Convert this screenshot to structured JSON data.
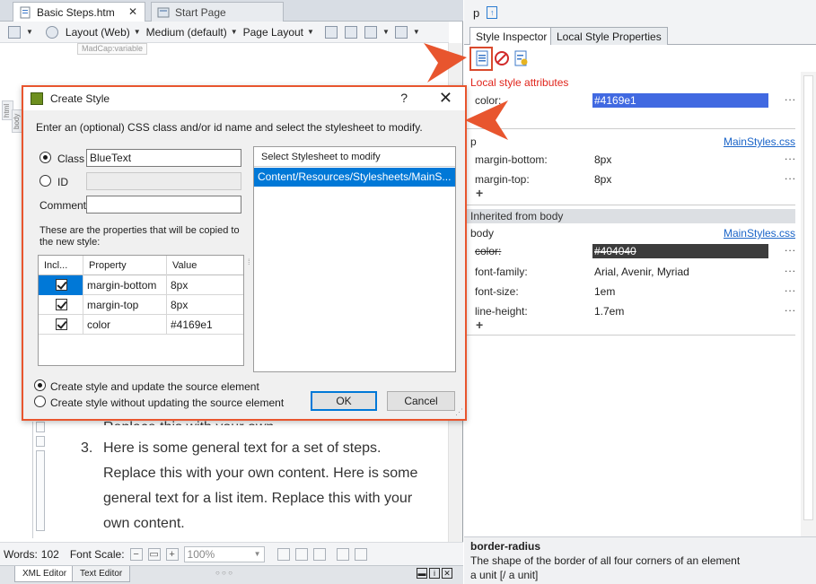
{
  "editor": {
    "tabs": [
      {
        "label": "Basic Steps.htm",
        "close": "✕"
      },
      {
        "label": "Start Page"
      }
    ],
    "toolbar": {
      "layout": "Layout (Web)",
      "medium": "Medium (default)",
      "page_layout": "Page Layout"
    },
    "variable_tag": "MadCap:variable",
    "gutter_tags": {
      "html": "html",
      "body": "body"
    },
    "partial_line": "Replace this with your own content.",
    "list_item": {
      "number": "3.",
      "text": "Here is some general text for a set of steps. Replace this with your own content. Here is some general text for a list item. Replace this with your own content."
    },
    "status": {
      "words_label": "Words:",
      "words_value": "102",
      "font_scale_label": "Font Scale:",
      "zoom": "100%"
    },
    "bottom_tabs": [
      "XML Editor",
      "Text Editor"
    ]
  },
  "panel": {
    "element": "p",
    "tabs": [
      "Style Inspector",
      "Local Style Properties"
    ],
    "local_section_title": "Local style attributes",
    "local_props": [
      {
        "name": "color:",
        "value": "#4169e1",
        "dots": "..."
      }
    ],
    "p_section": {
      "name": "p",
      "link": "MainStyles.css",
      "props": [
        {
          "name": "margin-bottom:",
          "value": "8px",
          "dots": "..."
        },
        {
          "name": "margin-top:",
          "value": "8px",
          "dots": "..."
        }
      ],
      "plus": "+"
    },
    "inherited_title": "Inherited from body",
    "body_section": {
      "name": "body",
      "link": "MainStyles.css",
      "props": [
        {
          "name": "color:",
          "value": "#404040",
          "dots": "..."
        },
        {
          "name": "font-family:",
          "value": "Arial, Avenir, Myriad",
          "dots": "..."
        },
        {
          "name": "font-size:",
          "value": "1em",
          "dots": "..."
        },
        {
          "name": "line-height:",
          "value": "1.7em",
          "dots": "..."
        }
      ],
      "plus": "+"
    },
    "description": {
      "title": "border-radius",
      "line1": "The shape of the border of all four corners of an element",
      "line2": "a unit [/ a unit]"
    }
  },
  "dialog": {
    "title": "Create Style",
    "help": "?",
    "close": "✕",
    "instructions": "Enter an (optional) CSS class and/or id name and select the stylesheet to modify.",
    "class_label": "Class",
    "class_value": "BlueText",
    "id_label": "ID",
    "id_value": "",
    "comment_label": "Comment:",
    "comment_value": "",
    "copy_note": "These are the properties that will be copied to the new style:",
    "grid_headers": [
      "Incl...",
      "Property",
      "Value"
    ],
    "grid_rows": [
      {
        "property": "margin-bottom",
        "value": "8px"
      },
      {
        "property": "margin-top",
        "value": "8px"
      },
      {
        "property": "color",
        "value": "#4169e1"
      }
    ],
    "stylesheet_header": "Select Stylesheet to modify",
    "stylesheet_item": "Content/Resources/Stylesheets/MainS...",
    "option_update": "Create style and update the source element",
    "option_no_update": "Create style without updating the source element",
    "ok": "OK",
    "cancel": "Cancel"
  },
  "colors": {
    "accent": "#e8552e",
    "selection": "#0078d7",
    "local_color": "#4169e1",
    "inherited_color": "#404040",
    "local_title": "#e0251c",
    "link": "#1a64c8"
  }
}
